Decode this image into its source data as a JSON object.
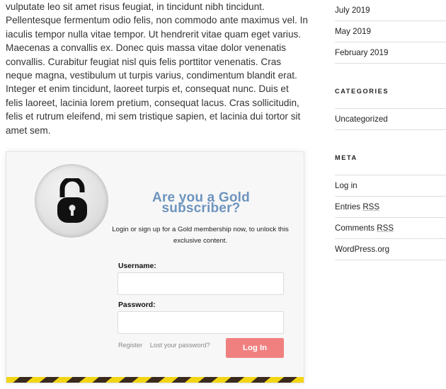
{
  "content": {
    "lines": [
      "vulputate leo sit amet risus feugiat, in tincidunt nibh tincidunt.",
      "Pellentesque fermentum odio felis, non commodo ante maximus vel. In",
      "iaculis tempor nulla vitae tempor. Ut hendrerit vitae quam eget varius.",
      "Maecenas a convallis ex. Donec quis massa vitae dolor venenatis",
      "convallis. Curabitur feugiat nisl quis felis porttitor venenatis. Cras",
      "neque magna, vestibulum ut turpis varius, condimentum blandit erat.",
      "Integer et enim tincidunt, laoreet turpis et, consequat nunc. Duis et",
      "felis laoreet, lacinia lorem pretium, consequat lacus. Cras sollicitudin,",
      "felis et rutrum eleifend, mi sem tristique sapien, et lacinia dui tortor sit",
      "amet sem."
    ]
  },
  "paywall": {
    "icon": "padlock-open-icon",
    "title_line1": "Are you a Gold",
    "title_line2": "subscriber?",
    "description_line1": "Login or sign up for a Gold membership now, to unlock this",
    "description_line2": "exclusive content.",
    "username_label": "Username:",
    "username_value": "",
    "password_label": "Password:",
    "password_value": "",
    "register_link": "Register",
    "lost_password_link": "Lost your password?",
    "login_button": "Log In",
    "colors": {
      "title": "#6d94be",
      "button": "#f08080",
      "stripe_a": "#f2d513",
      "stripe_b": "#3a2a1e"
    }
  },
  "sidebar": {
    "archives": [
      "July 2019",
      "May 2019",
      "February 2019"
    ],
    "categories_title": "CATEGORIES",
    "categories": [
      "Uncategorized"
    ],
    "meta_title": "META",
    "meta": {
      "login": "Log in",
      "entries_prefix": "Entries ",
      "entries_rss": "RSS",
      "comments_prefix": "Comments ",
      "comments_rss": "RSS",
      "wordpress": "WordPress.org"
    }
  }
}
